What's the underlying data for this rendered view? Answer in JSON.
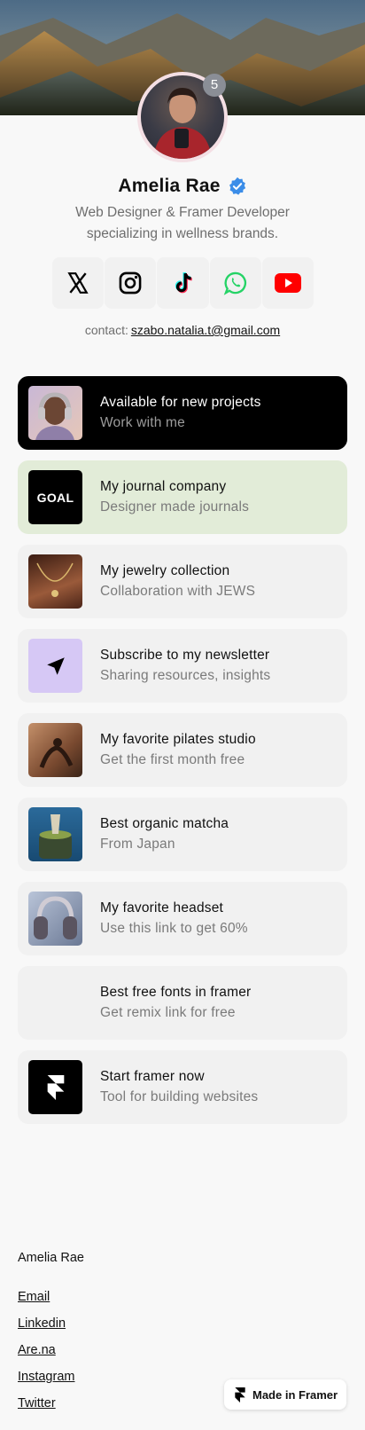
{
  "profile": {
    "name": "Amelia Rae",
    "bio": "Web Designer & Framer Developer specializing in wellness brands.",
    "badge_count": "5",
    "verified_icon": "verified-check-icon",
    "verified_color": "#3b8de8"
  },
  "socials": [
    {
      "name": "x-icon",
      "color": "#000000"
    },
    {
      "name": "instagram-icon",
      "color": "#000000"
    },
    {
      "name": "tiktok-icon",
      "color": "#000000"
    },
    {
      "name": "whatsapp-icon",
      "color": "#25d366"
    },
    {
      "name": "youtube-icon",
      "color": "#ff0000"
    }
  ],
  "contact": {
    "label": "contact:",
    "email": "szabo.natalia.t@gmail.com"
  },
  "links": [
    {
      "title": "Available for new projects",
      "subtitle": "Work with me",
      "thumb": "portrait-headphones"
    },
    {
      "title": "My journal company",
      "subtitle": "Designer made journals",
      "thumb_text": "GOAL",
      "thumb": "goal-logo"
    },
    {
      "title": "My jewelry collection",
      "subtitle": "Collaboration with JEWS",
      "thumb": "necklace-photo"
    },
    {
      "title": "Subscribe to my newsletter",
      "subtitle": "Sharing resources, insights",
      "thumb": "send-arrow-icon"
    },
    {
      "title": "My favorite pilates studio",
      "subtitle": "Get the first month free",
      "thumb": "pilates-photo"
    },
    {
      "title": "Best organic matcha",
      "subtitle": "From Japan",
      "thumb": "matcha-photo"
    },
    {
      "title": "My favorite headset",
      "subtitle": "Use this link to get 60%",
      "thumb": "headset-photo"
    },
    {
      "title": "Best free fonts in framer",
      "subtitle": "Get remix link for free",
      "thumb": "empty"
    },
    {
      "title": "Start framer now",
      "subtitle": "Tool for building websites",
      "thumb": "framer-logo"
    }
  ],
  "footer": {
    "name": "Amelia Rae",
    "links": [
      "Email",
      "Linkedin",
      "Are.na",
      "Instagram",
      "Twitter"
    ]
  },
  "made_in": {
    "label": "Made in Framer"
  },
  "colors": {
    "background": "#f8f8f8",
    "card": "#f1f1f1",
    "card_dark": "#000000",
    "card_green": "#e2ecd8",
    "newsletter_thumb": "#d6c8f5"
  }
}
